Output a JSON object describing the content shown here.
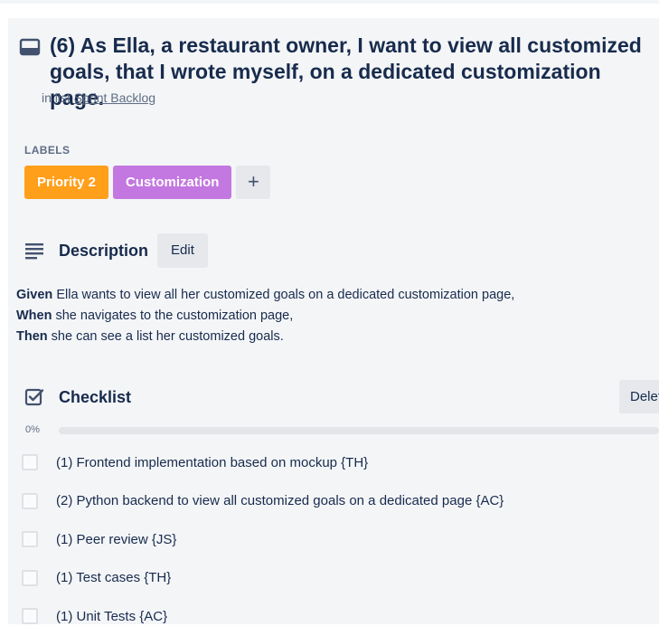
{
  "card": {
    "title": "(6) As Ella, a restaurant owner, I want to view all customized goals, that I wrote myself, on a dedicated customization page.",
    "in_list_prefix": "in list",
    "list_name": "Sprint Backlog"
  },
  "labels": {
    "heading": "LABELS",
    "items": [
      {
        "text": "Priority 2",
        "color": "#ff9f1a"
      },
      {
        "text": "Customization",
        "color": "#c377e0"
      }
    ],
    "add_symbol": "+"
  },
  "description": {
    "heading": "Description",
    "edit_label": "Edit",
    "lines": [
      {
        "keyword": "Given",
        "text": " Ella wants to view all her customized goals on a dedicated customization page,"
      },
      {
        "keyword": "When",
        "text": " she navigates to the customization page,"
      },
      {
        "keyword": "Then",
        "text": " she can see a list her customized goals."
      }
    ]
  },
  "checklist": {
    "heading": "Checklist",
    "delete_label": "Delete",
    "progress_text": "0%",
    "progress_value": 0,
    "items": [
      {
        "text": "(1) Frontend implementation based on mockup {TH}",
        "checked": false
      },
      {
        "text": "(2) Python backend to view all customized goals on a dedicated page {AC}",
        "checked": false
      },
      {
        "text": "(1) Peer review {JS}",
        "checked": false
      },
      {
        "text": "(1) Test cases {TH}",
        "checked": false
      },
      {
        "text": "(1) Unit Tests {AC}",
        "checked": false
      }
    ]
  },
  "icons": {
    "card": "card-icon",
    "description": "description-lines-icon",
    "checklist": "checklist-checkbox-icon"
  },
  "colors": {
    "text": "#172b4d",
    "muted": "#5e6c84",
    "panel": "#f4f5f7",
    "button": "#e6e8ec"
  }
}
